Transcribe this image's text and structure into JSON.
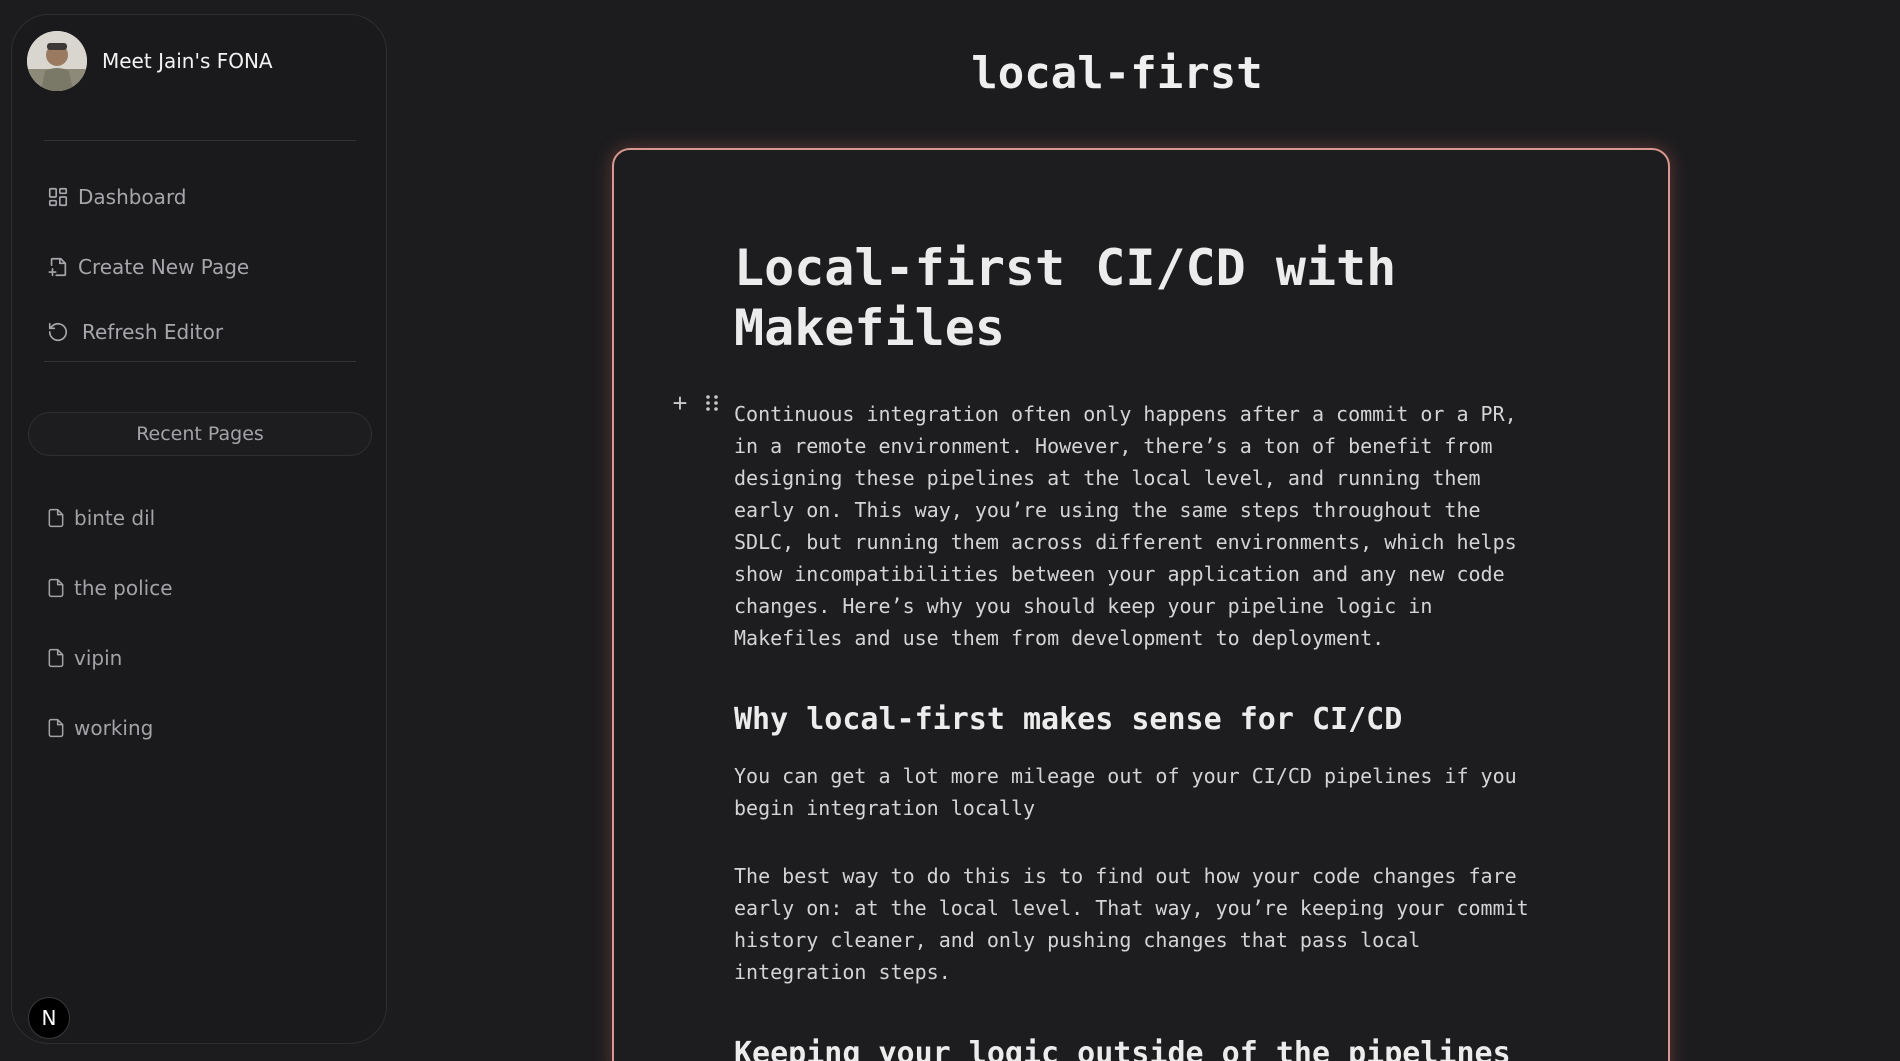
{
  "profile": {
    "name": "Meet Jain's FONA"
  },
  "nav": {
    "dashboard": "Dashboard",
    "create_new_page": "Create New Page",
    "refresh_editor": "Refresh Editor"
  },
  "recent": {
    "heading": "Recent Pages",
    "items": [
      "binte dil",
      "the police",
      "vipin",
      "working"
    ]
  },
  "badge": {
    "letter": "N"
  },
  "document": {
    "page_title": "local-first",
    "heading": "Local-first CI/CD with Makefiles",
    "intro": "Continuous integration often only happens after a commit or a PR, in a remote environment. However, there’s a ton of benefit from designing these pipelines at the local level, and running them early on. This way, you’re using the same steps throughout the SDLC, but running them across different environments, which helps show incompatibilities between your application and any new code changes. Here’s why you should keep your pipeline logic in Makefiles and use them from development to deployment.",
    "section1_heading": "Why local-first makes sense for CI/CD",
    "section1_p1": "You can get a lot more mileage out of your CI/CD pipelines if you begin integration locally",
    "section1_p2": "The best way to do this is to find out how your code changes fare early on: at the local level. That way, you’re keeping your commit history cleaner, and only pushing changes that pass local integration steps.",
    "section2_heading": "Keeping your logic outside of the pipelines"
  },
  "colors": {
    "background": "#1c1c1e",
    "card_border": "#d7998f",
    "text": "#d4d4d6"
  },
  "icons": {
    "dashboard": "dashboard-grid-icon",
    "create_page": "file-plus-icon",
    "refresh": "refresh-icon",
    "page": "file-icon",
    "add_block": "plus-icon",
    "drag_handle": "grip-icon"
  }
}
